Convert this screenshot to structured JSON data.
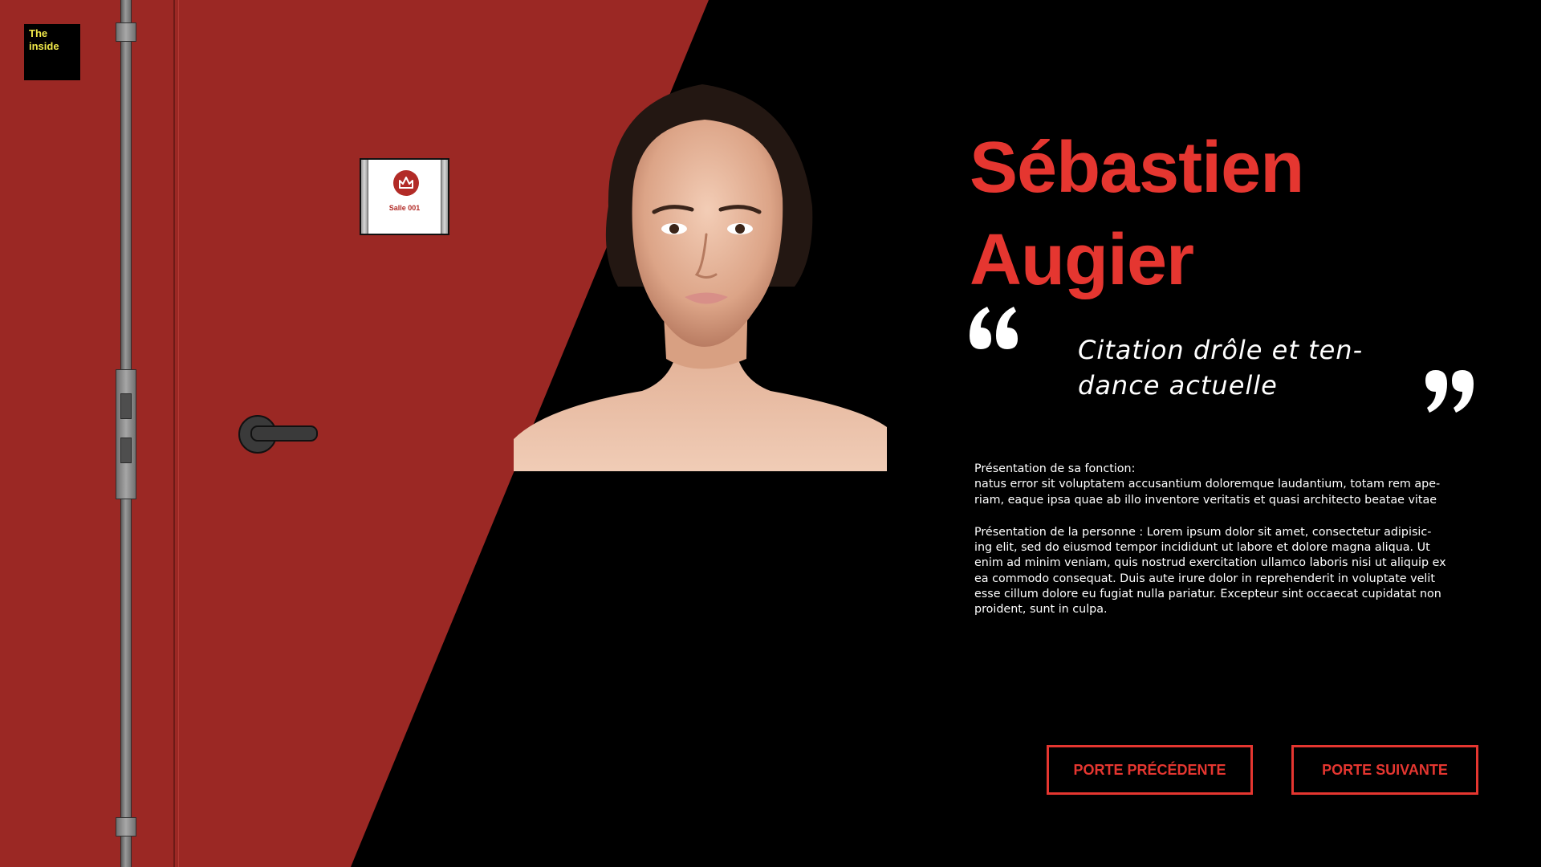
{
  "brand": {
    "logo_line1": "The",
    "logo_line2": "inside"
  },
  "door": {
    "room_label": "Salle 001"
  },
  "person": {
    "name_line1": "Sébastien",
    "name_line2": "Augier",
    "quote_line1": "Citation drôle et ten-",
    "quote_line2": "dance actuelle",
    "function_heading": "Présentation de sa fonction:",
    "function_line1": "natus error sit voluptatem accusantium doloremque laudantium, totam rem ape-",
    "function_line2": "riam, eaque ipsa quae ab illo inventore veritatis et quasi architecto beatae vitae",
    "bio_line1": "Présentation de la personne : Lorem ipsum dolor sit amet, consectetur adipisic-",
    "bio_line2": "ing elit, sed do eiusmod tempor incididunt ut labore et dolore magna aliqua. Ut",
    "bio_line3": "enim ad minim veniam, quis nostrud exercitation ullamco laboris nisi ut aliquip ex",
    "bio_line4": "ea commodo consequat. Duis aute irure dolor in reprehenderit in voluptate velit",
    "bio_line5": "esse cillum dolore eu fugiat nulla pariatur. Excepteur sint occaecat cupidatat non",
    "bio_line6": "proident, sunt in culpa."
  },
  "navigation": {
    "previous_label": "PORTE PRÉCÉDENTE",
    "next_label": "PORTE SUIVANTE"
  },
  "icons": {
    "room_sign_logo": "crown-icon",
    "quote_open": "quote-open-icon",
    "quote_close": "quote-close-icon"
  },
  "colors": {
    "door_red": "#9b2824",
    "accent_red": "#e53630",
    "background": "#000000",
    "logo_yellow": "#f1e94a"
  }
}
